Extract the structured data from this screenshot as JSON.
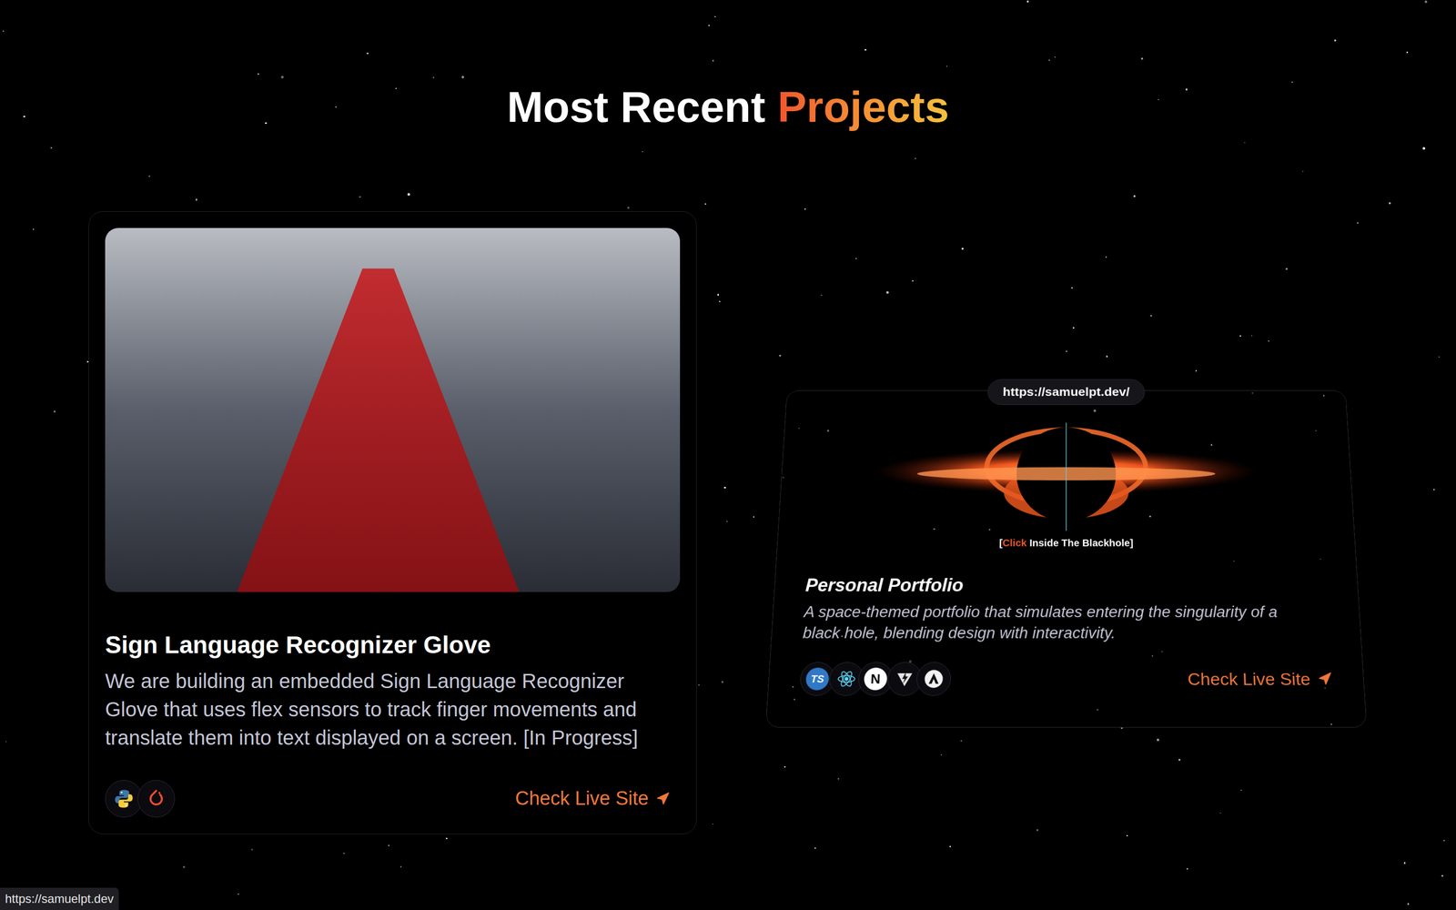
{
  "heading": {
    "lead": "Most Recent ",
    "accent": "Projects"
  },
  "projects": [
    {
      "title": "Sign Language Recognizer Glove",
      "description": "We are building an embedded Sign Language Recognizer Glove that uses flex sensors to track finger movements and translate them into text displayed on a screen. [In Progress]",
      "tech": [
        {
          "kind": "python"
        },
        {
          "kind": "pytorch"
        }
      ],
      "link": "Check Live Site",
      "kind": "photo"
    },
    {
      "title": "Personal Portfolio",
      "description": "A space-themed portfolio that simulates entering the singularity of a black hole, blending design with interactivity.",
      "tech": [
        {
          "kind": "text",
          "label": "TS"
        },
        {
          "kind": "react"
        },
        {
          "kind": "letter",
          "label": "N"
        },
        {
          "kind": "vite"
        },
        {
          "kind": "astro"
        }
      ],
      "link": "Check Live Site",
      "kind": "preview",
      "preview": {
        "url": "https://samuelpt.dev/",
        "hint_open": "[",
        "hint_action": "Click",
        "hint_rest": " Inside The Blackhole]"
      }
    }
  ],
  "status_bar": "https://samuelpt.dev"
}
